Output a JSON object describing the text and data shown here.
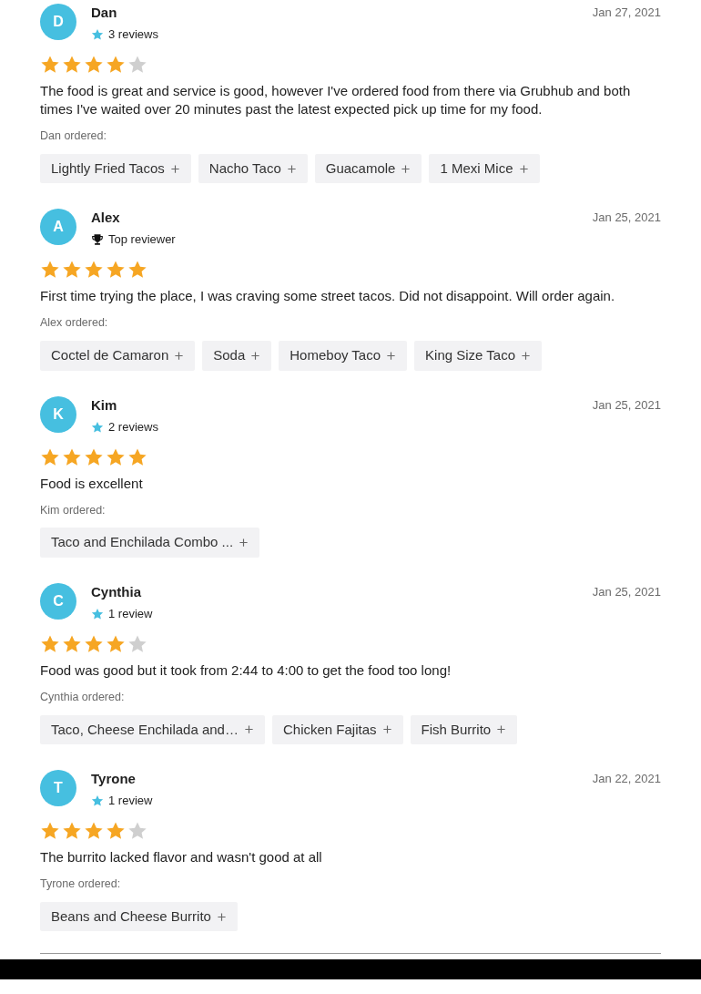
{
  "reviews": [
    {
      "initial": "D",
      "name": "Dan",
      "badge": {
        "kind": "reviews",
        "text": "3 reviews"
      },
      "date": "Jan 27, 2021",
      "stars": 4,
      "text": "The food is great and service is good, however I've ordered food from there via Grubhub and both times I've waited over 20 minutes past the latest expected pick up time for my food.",
      "ordered_label": "Dan ordered:",
      "items": [
        "Lightly Fried Tacos",
        "Nacho Taco",
        "Guacamole",
        "1 Mexi Mice"
      ]
    },
    {
      "initial": "A",
      "name": "Alex",
      "badge": {
        "kind": "top",
        "text": "Top reviewer"
      },
      "date": "Jan 25, 2021",
      "stars": 5,
      "text": "First time trying the place, I was craving some street tacos. Did not disappoint. Will order again.",
      "ordered_label": "Alex ordered:",
      "items": [
        "Coctel de Camaron",
        "Soda",
        "Homeboy Taco",
        "King Size Taco"
      ]
    },
    {
      "initial": "K",
      "name": "Kim",
      "badge": {
        "kind": "reviews",
        "text": "2 reviews"
      },
      "date": "Jan 25, 2021",
      "stars": 5,
      "text": "Food is excellent",
      "ordered_label": "Kim ordered:",
      "items": [
        "Taco and Enchilada Combo ..."
      ]
    },
    {
      "initial": "C",
      "name": "Cynthia",
      "badge": {
        "kind": "reviews",
        "text": "1 review"
      },
      "date": "Jan 25, 2021",
      "stars": 4,
      "text": "Food was good but it took from 2:44 to 4:00 to get the food too long!",
      "ordered_label": "Cynthia ordered:",
      "items": [
        "Taco, Cheese Enchilada and…",
        "Chicken Fajitas",
        "Fish Burrito"
      ]
    },
    {
      "initial": "T",
      "name": "Tyrone",
      "badge": {
        "kind": "reviews",
        "text": "1 review"
      },
      "date": "Jan 22, 2021",
      "stars": 4,
      "text": "The burrito lacked flavor and wasn't good at all",
      "ordered_label": "Tyrone ordered:",
      "items": [
        "Beans and Cheese Burrito"
      ]
    }
  ]
}
